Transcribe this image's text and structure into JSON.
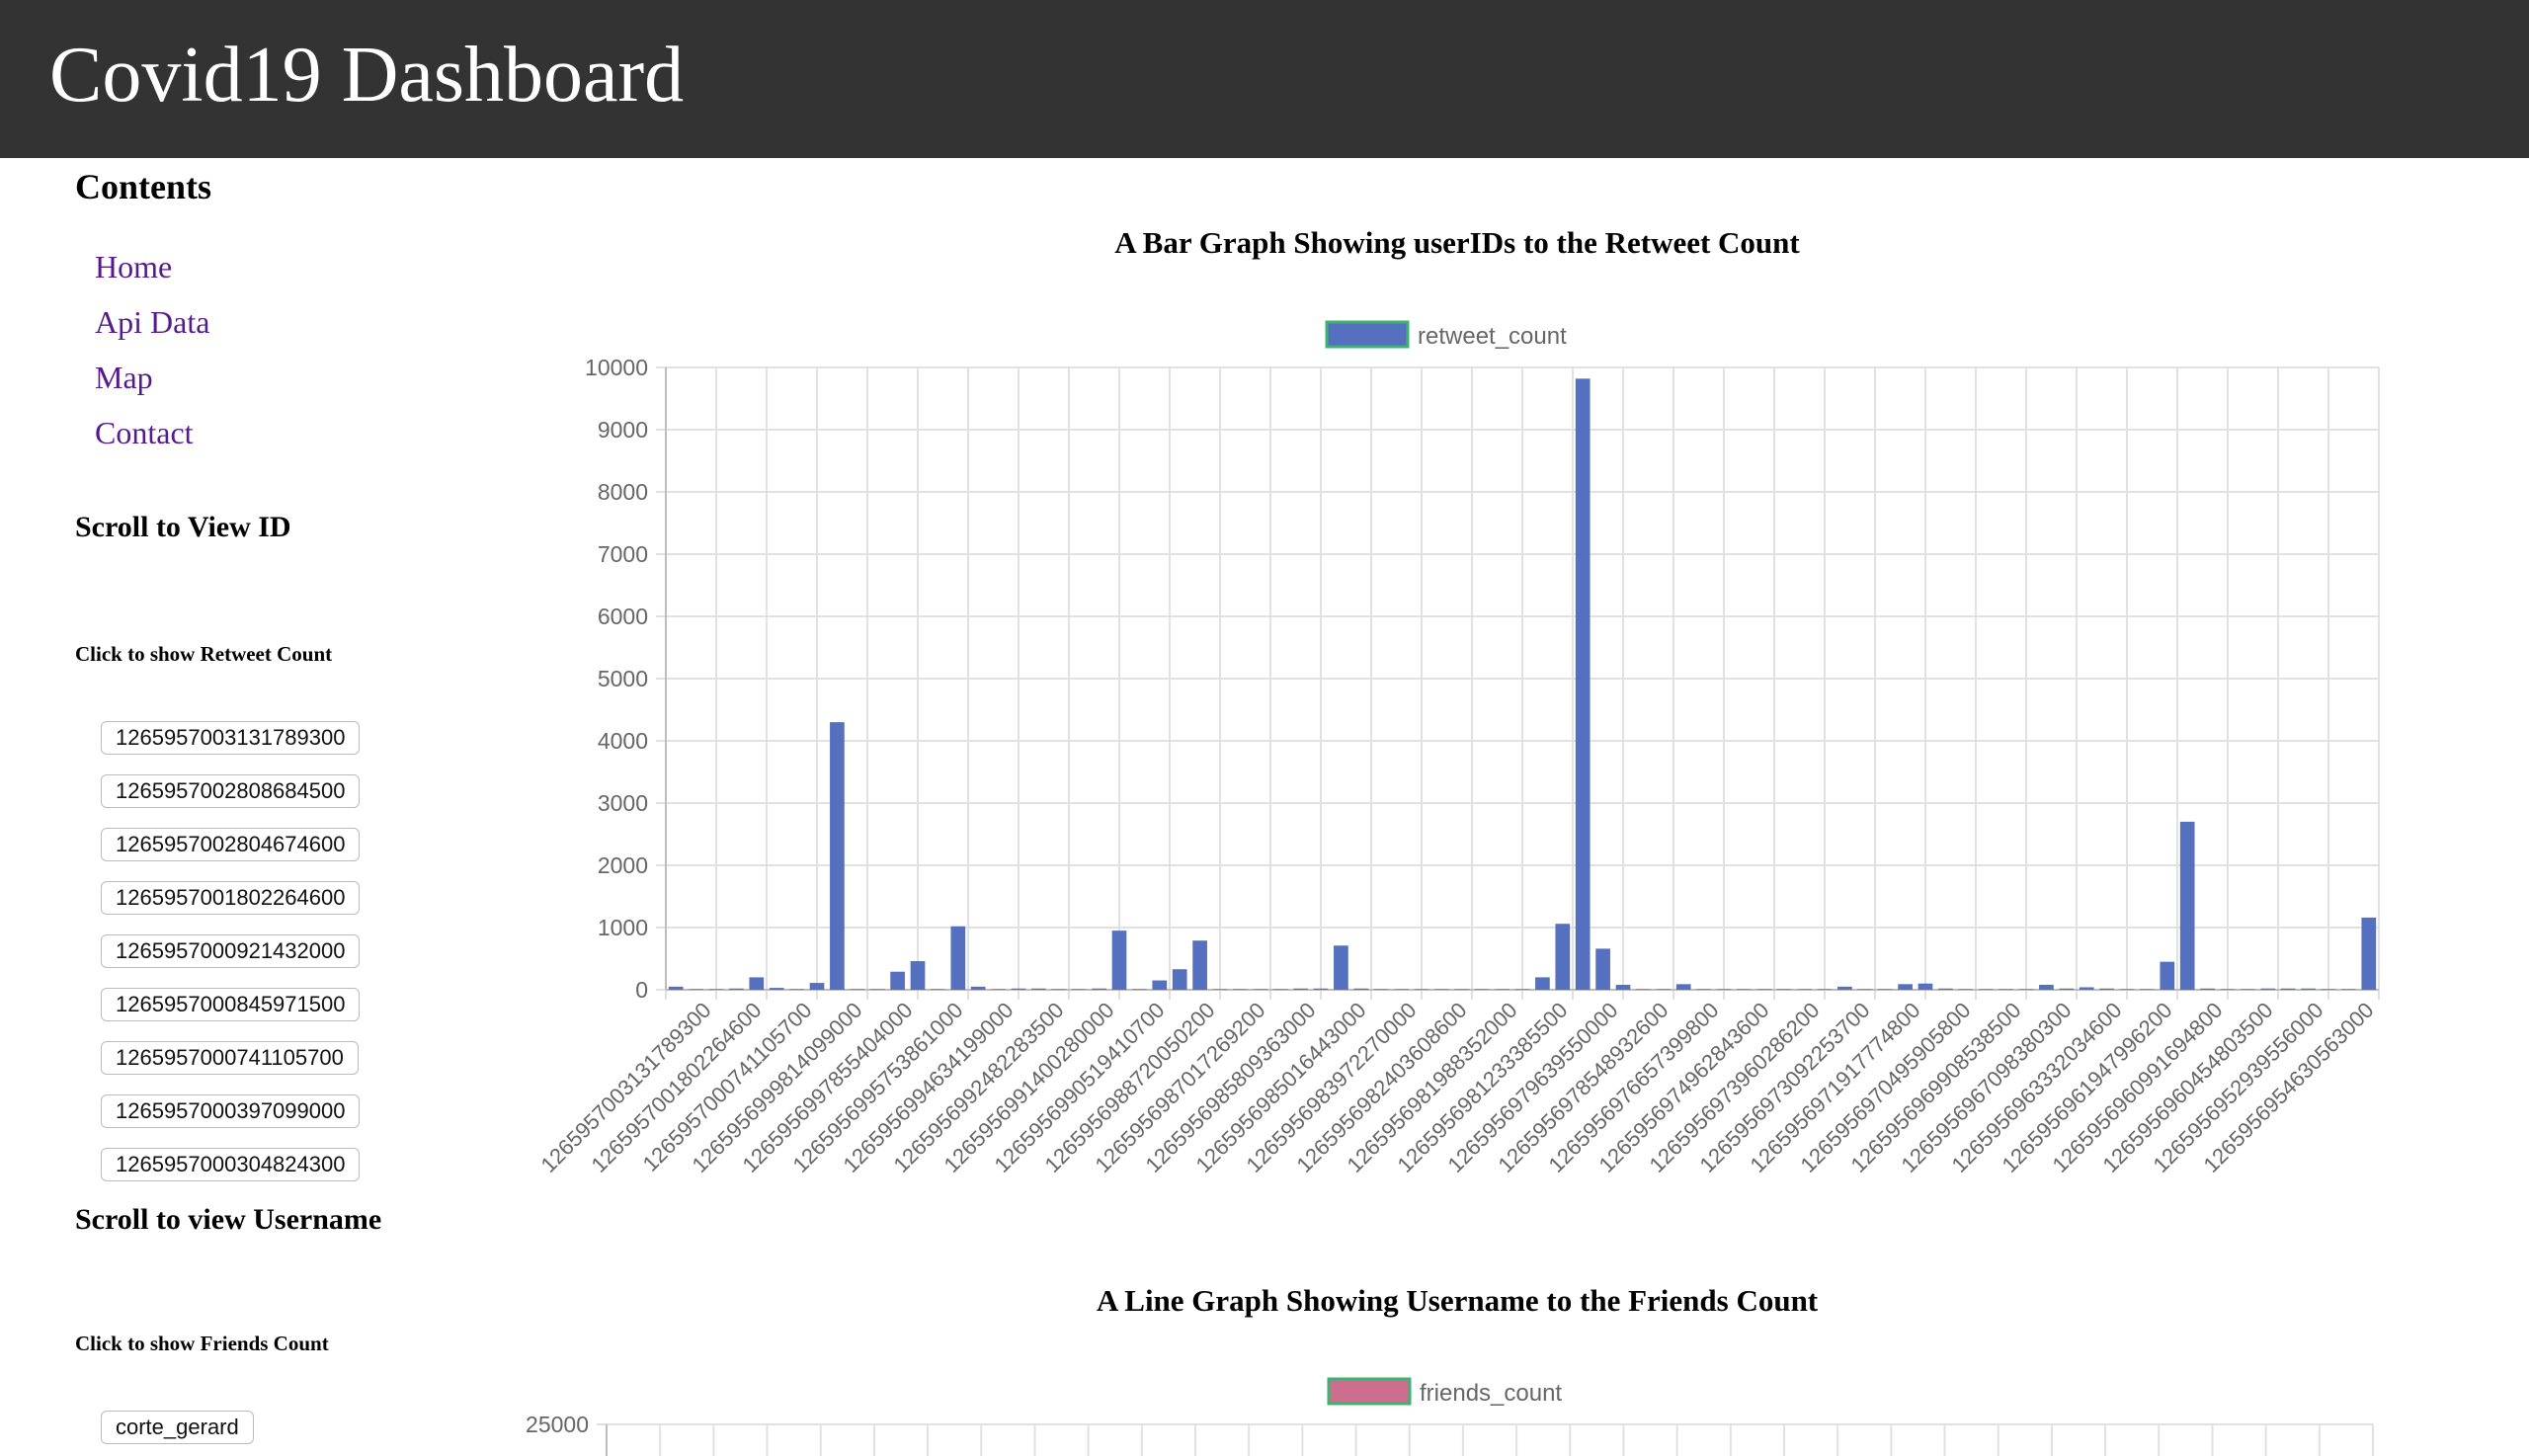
{
  "header": {
    "title": "Covid19 Dashboard"
  },
  "sidebar": {
    "contents_heading": "Contents",
    "nav": [
      "Home",
      "Api Data",
      "Map",
      "Contact"
    ],
    "id_section": {
      "heading": "Scroll to View ID",
      "subheading": "Click to show Retweet Count",
      "ids": [
        "1265957003131789300",
        "1265957002808684500",
        "1265957002804674600",
        "1265957001802264600",
        "1265957000921432000",
        "1265957000845971500",
        "1265957000741105700",
        "1265957000397099000",
        "1265957000304824300"
      ]
    },
    "username_section": {
      "heading": "Scroll to view Username",
      "subheading": "Click to show Friends Count",
      "usernames": [
        "corte_gerard"
      ]
    }
  },
  "chart_data": [
    {
      "type": "bar",
      "title": "A Bar Graph Showing userIDs to the Retweet Count",
      "legend": "retweet_count",
      "legend_position": "top",
      "grid": true,
      "ylim": [
        0,
        10000
      ],
      "yticks": [
        0,
        1000,
        2000,
        3000,
        4000,
        5000,
        6000,
        7000,
        8000,
        9000,
        10000
      ],
      "colors": {
        "bar": "#5470be",
        "legend_border": "#3cb371"
      },
      "categories": [
        "1265957003131789300",
        "1265957001802264600",
        "1265957000741105700",
        "1265956999814099000",
        "1265956997855404000",
        "1265956995753861000",
        "1265956994634199000",
        "1265956992482283500",
        "1265956991400280000",
        "1265956990519410700",
        "1265956988720050200",
        "1265956987017269200",
        "1265956985809363000",
        "1265956985016443000",
        "1265956983972270000",
        "1265956982403608600",
        "1265956981988352000",
        "1265956981233385500",
        "1265956979639550000",
        "1265956978548932600",
        "1265956976657399800",
        "1265956974962843600",
        "1265956973960286200",
        "1265956973092253700",
        "1265956971917774800",
        "1265956970495905800",
        "1265956969908538500",
        "1265956967098380300",
        "1265956963332034600",
        "1265956961947996200",
        "1265956960991694800",
        "1265956960454803500",
        "1265956952939556000",
        "1265956954630563000"
      ],
      "values": [
        50,
        10,
        10,
        20,
        200,
        30,
        10,
        110,
        4300,
        10,
        10,
        290,
        460,
        10,
        1020,
        50,
        10,
        20,
        20,
        10,
        10,
        20,
        950,
        10,
        150,
        330,
        790,
        10,
        10,
        10,
        10,
        20,
        20,
        710,
        20,
        10,
        10,
        10,
        10,
        10,
        10,
        10,
        10,
        200,
        1060,
        9820,
        660,
        80,
        10,
        10,
        90,
        10,
        10,
        10,
        10,
        10,
        10,
        10,
        50,
        10,
        10,
        90,
        100,
        20,
        10,
        10,
        10,
        10,
        80,
        20,
        40,
        20,
        10,
        10,
        450,
        2700,
        20,
        10,
        10,
        20,
        20,
        20,
        10,
        10,
        1160
      ]
    },
    {
      "type": "line",
      "title": "A Line Graph Showing Username to the Friends Count",
      "legend": "friends_count",
      "legend_position": "top",
      "grid": true,
      "yticks": [
        25000
      ],
      "colors": {
        "line": "#cc6f8f",
        "legend_border": "#3cb371"
      }
    }
  ]
}
